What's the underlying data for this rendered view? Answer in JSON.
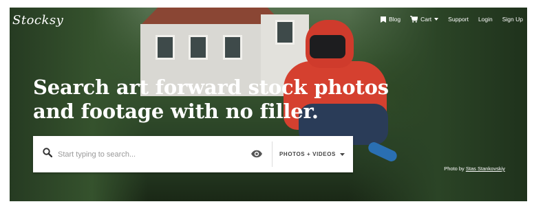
{
  "brand": {
    "logo_text": "Stocksy"
  },
  "nav": {
    "items": [
      {
        "label": "Blog",
        "icon": "bookmark-icon"
      },
      {
        "label": "Cart",
        "icon": "cart-icon",
        "has_dropdown": true
      },
      {
        "label": "Support"
      },
      {
        "label": "Login"
      },
      {
        "label": "Sign Up"
      }
    ]
  },
  "hero": {
    "headline_line1": "Search art forward stock photos",
    "headline_line2": "and footage with no filler."
  },
  "search": {
    "placeholder": "Start typing to search...",
    "filter_label": "PHOTOS + VIDEOS"
  },
  "credit": {
    "prefix": "Photo by ",
    "author": "Stas Stankovskiy"
  },
  "colors": {
    "text_on_photo": "#ffffff",
    "search_bg": "#ffffff",
    "search_text": "#444444"
  }
}
